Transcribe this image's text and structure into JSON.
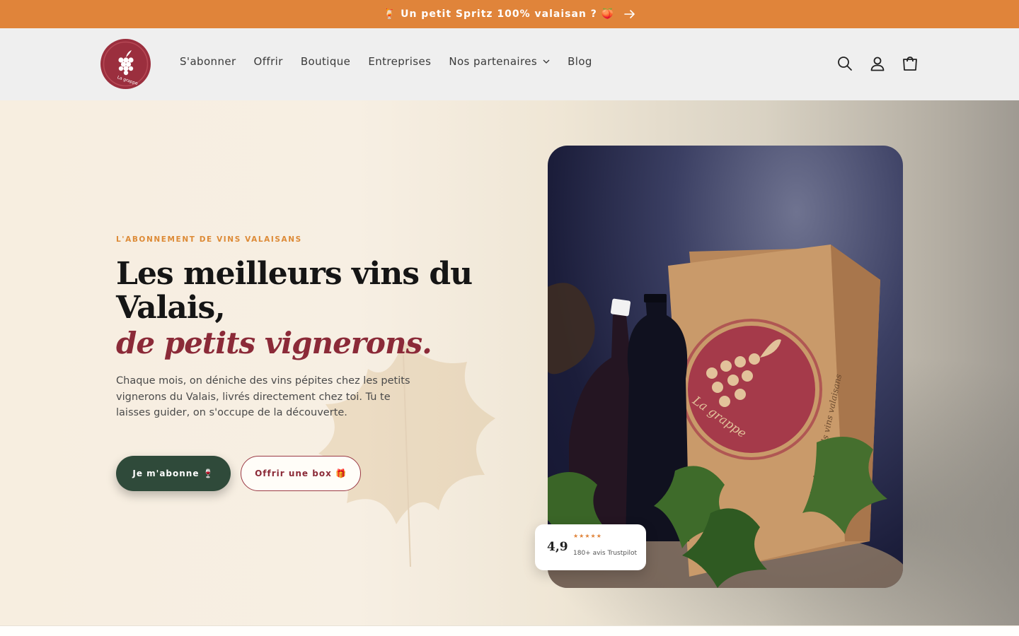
{
  "announcement": {
    "text": "🍹 Un petit Spritz 100% valaisan ? 🍑",
    "arrow_icon": "arrow-right-icon"
  },
  "header": {
    "logo_text": "La grappe",
    "nav": [
      {
        "label": "S'abonner"
      },
      {
        "label": "Offrir"
      },
      {
        "label": "Boutique"
      },
      {
        "label": "Entreprises"
      },
      {
        "label": "Nos partenaires",
        "has_dropdown": true
      },
      {
        "label": "Blog"
      }
    ],
    "icons": [
      "search-icon",
      "account-icon",
      "cart-icon"
    ]
  },
  "hero": {
    "eyebrow": "L'ABONNEMENT DE VINS VALAISANS",
    "headline": "Les meilleurs vins du Valais,",
    "headline_accent": "de petits vignerons.",
    "description": "Chaque mois, on déniche des vins pépites chez les petits vignerons du Valais, livrés directement chez toi. Tu te laisses guider, on s'occupe de la découverte.",
    "primary_button": "Je m'abonne 🍷",
    "secondary_button": "Offrir une box 🎁",
    "box_text": "La grappe",
    "box_side_text": "tite des grands vins valaisans"
  },
  "rating": {
    "score": "4,9",
    "stars": "★★★★★",
    "text": "180+ avis Trustpilot"
  },
  "colors": {
    "announcement_bg": "#e0843a",
    "accent": "#8b2a38",
    "primary_button": "#2f4a3a",
    "eyebrow": "#dd8a36"
  }
}
